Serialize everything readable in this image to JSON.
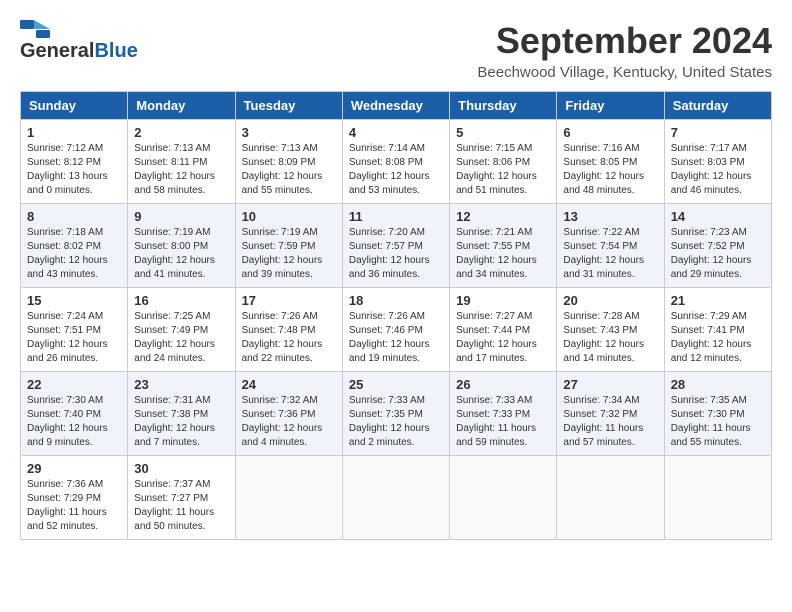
{
  "header": {
    "logo_line1": "General",
    "logo_line2": "Blue",
    "month_title": "September 2024",
    "location": "Beechwood Village, Kentucky, United States"
  },
  "weekdays": [
    "Sunday",
    "Monday",
    "Tuesday",
    "Wednesday",
    "Thursday",
    "Friday",
    "Saturday"
  ],
  "weeks": [
    [
      {
        "day": "1",
        "info": "Sunrise: 7:12 AM\nSunset: 8:12 PM\nDaylight: 13 hours\nand 0 minutes."
      },
      {
        "day": "2",
        "info": "Sunrise: 7:13 AM\nSunset: 8:11 PM\nDaylight: 12 hours\nand 58 minutes."
      },
      {
        "day": "3",
        "info": "Sunrise: 7:13 AM\nSunset: 8:09 PM\nDaylight: 12 hours\nand 55 minutes."
      },
      {
        "day": "4",
        "info": "Sunrise: 7:14 AM\nSunset: 8:08 PM\nDaylight: 12 hours\nand 53 minutes."
      },
      {
        "day": "5",
        "info": "Sunrise: 7:15 AM\nSunset: 8:06 PM\nDaylight: 12 hours\nand 51 minutes."
      },
      {
        "day": "6",
        "info": "Sunrise: 7:16 AM\nSunset: 8:05 PM\nDaylight: 12 hours\nand 48 minutes."
      },
      {
        "day": "7",
        "info": "Sunrise: 7:17 AM\nSunset: 8:03 PM\nDaylight: 12 hours\nand 46 minutes."
      }
    ],
    [
      {
        "day": "8",
        "info": "Sunrise: 7:18 AM\nSunset: 8:02 PM\nDaylight: 12 hours\nand 43 minutes."
      },
      {
        "day": "9",
        "info": "Sunrise: 7:19 AM\nSunset: 8:00 PM\nDaylight: 12 hours\nand 41 minutes."
      },
      {
        "day": "10",
        "info": "Sunrise: 7:19 AM\nSunset: 7:59 PM\nDaylight: 12 hours\nand 39 minutes."
      },
      {
        "day": "11",
        "info": "Sunrise: 7:20 AM\nSunset: 7:57 PM\nDaylight: 12 hours\nand 36 minutes."
      },
      {
        "day": "12",
        "info": "Sunrise: 7:21 AM\nSunset: 7:55 PM\nDaylight: 12 hours\nand 34 minutes."
      },
      {
        "day": "13",
        "info": "Sunrise: 7:22 AM\nSunset: 7:54 PM\nDaylight: 12 hours\nand 31 minutes."
      },
      {
        "day": "14",
        "info": "Sunrise: 7:23 AM\nSunset: 7:52 PM\nDaylight: 12 hours\nand 29 minutes."
      }
    ],
    [
      {
        "day": "15",
        "info": "Sunrise: 7:24 AM\nSunset: 7:51 PM\nDaylight: 12 hours\nand 26 minutes."
      },
      {
        "day": "16",
        "info": "Sunrise: 7:25 AM\nSunset: 7:49 PM\nDaylight: 12 hours\nand 24 minutes."
      },
      {
        "day": "17",
        "info": "Sunrise: 7:26 AM\nSunset: 7:48 PM\nDaylight: 12 hours\nand 22 minutes."
      },
      {
        "day": "18",
        "info": "Sunrise: 7:26 AM\nSunset: 7:46 PM\nDaylight: 12 hours\nand 19 minutes."
      },
      {
        "day": "19",
        "info": "Sunrise: 7:27 AM\nSunset: 7:44 PM\nDaylight: 12 hours\nand 17 minutes."
      },
      {
        "day": "20",
        "info": "Sunrise: 7:28 AM\nSunset: 7:43 PM\nDaylight: 12 hours\nand 14 minutes."
      },
      {
        "day": "21",
        "info": "Sunrise: 7:29 AM\nSunset: 7:41 PM\nDaylight: 12 hours\nand 12 minutes."
      }
    ],
    [
      {
        "day": "22",
        "info": "Sunrise: 7:30 AM\nSunset: 7:40 PM\nDaylight: 12 hours\nand 9 minutes."
      },
      {
        "day": "23",
        "info": "Sunrise: 7:31 AM\nSunset: 7:38 PM\nDaylight: 12 hours\nand 7 minutes."
      },
      {
        "day": "24",
        "info": "Sunrise: 7:32 AM\nSunset: 7:36 PM\nDaylight: 12 hours\nand 4 minutes."
      },
      {
        "day": "25",
        "info": "Sunrise: 7:33 AM\nSunset: 7:35 PM\nDaylight: 12 hours\nand 2 minutes."
      },
      {
        "day": "26",
        "info": "Sunrise: 7:33 AM\nSunset: 7:33 PM\nDaylight: 11 hours\nand 59 minutes."
      },
      {
        "day": "27",
        "info": "Sunrise: 7:34 AM\nSunset: 7:32 PM\nDaylight: 11 hours\nand 57 minutes."
      },
      {
        "day": "28",
        "info": "Sunrise: 7:35 AM\nSunset: 7:30 PM\nDaylight: 11 hours\nand 55 minutes."
      }
    ],
    [
      {
        "day": "29",
        "info": "Sunrise: 7:36 AM\nSunset: 7:29 PM\nDaylight: 11 hours\nand 52 minutes."
      },
      {
        "day": "30",
        "info": "Sunrise: 7:37 AM\nSunset: 7:27 PM\nDaylight: 11 hours\nand 50 minutes."
      },
      {
        "day": "",
        "info": ""
      },
      {
        "day": "",
        "info": ""
      },
      {
        "day": "",
        "info": ""
      },
      {
        "day": "",
        "info": ""
      },
      {
        "day": "",
        "info": ""
      }
    ]
  ]
}
